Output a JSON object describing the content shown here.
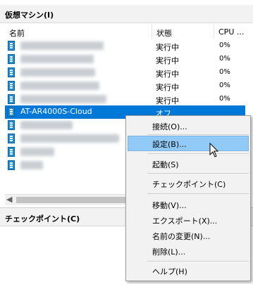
{
  "vm_pane": {
    "title": "仮想マシン(I)",
    "columns": {
      "name": "名前",
      "state": "状態",
      "cpu": "CPU ..."
    },
    "rows": [
      {
        "name": "",
        "state": "実行中",
        "cpu": "0%"
      },
      {
        "name": "",
        "state": "実行中",
        "cpu": "0%"
      },
      {
        "name": "",
        "state": "実行中",
        "cpu": "0%"
      },
      {
        "name": "",
        "state": "実行中",
        "cpu": "0%"
      },
      {
        "name": "",
        "state": "実行中",
        "cpu": "0%"
      },
      {
        "name": "AT-AR4000S-Cloud",
        "state": "オフ",
        "cpu": ""
      },
      {
        "name": "",
        "state": "",
        "cpu": ""
      },
      {
        "name": "",
        "state": "",
        "cpu": ""
      },
      {
        "name": "",
        "state": "",
        "cpu": ""
      },
      {
        "name": "",
        "state": "",
        "cpu": ""
      }
    ]
  },
  "checkpoint_pane": {
    "title": "チェックポイント(C)"
  },
  "context_menu": {
    "items": [
      "接続(O)...",
      "設定(B)...",
      "起動(S)",
      "チェックポイント(C)",
      "移動(V)...",
      "エクスポート(X)...",
      "名前の変更(N)...",
      "削除(L)...",
      "ヘルプ(H)"
    ]
  },
  "colors": {
    "selection": "#0078d7",
    "menu_hover": "#91c9f7",
    "vm_icon": "#1f8fd8"
  }
}
